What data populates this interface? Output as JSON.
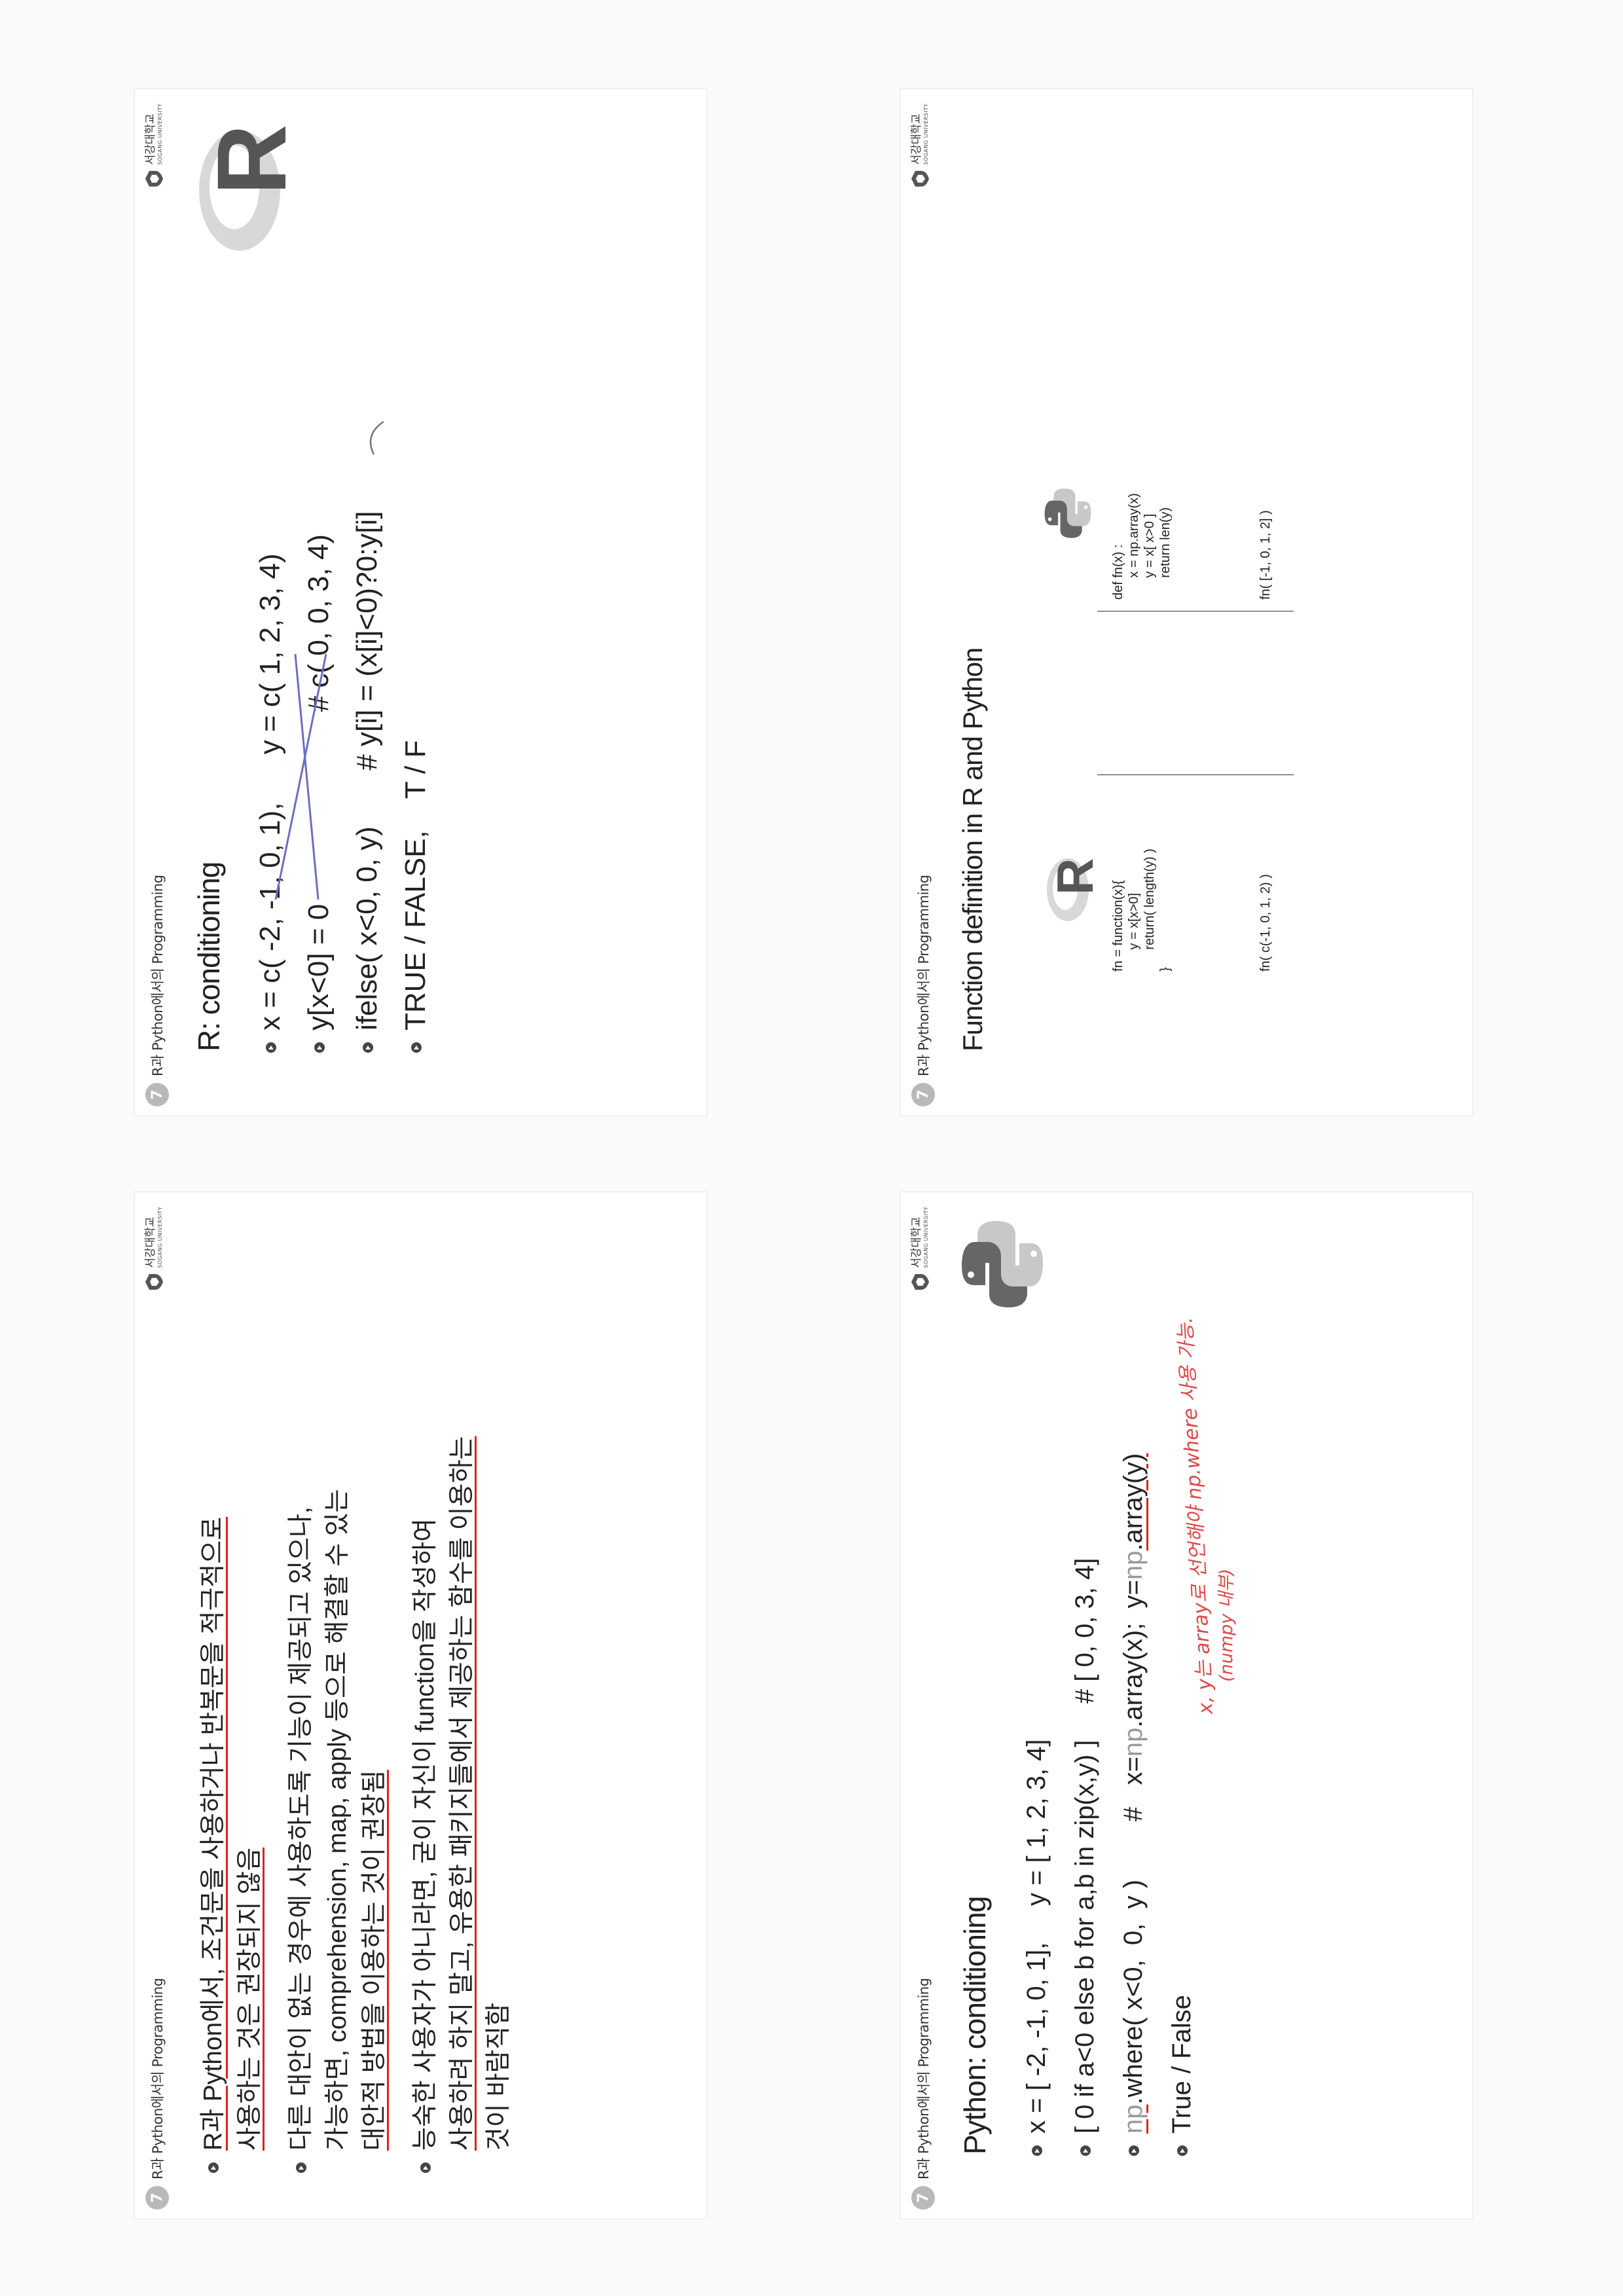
{
  "header": {
    "slide_number": "7",
    "course": "R과 Python에서의 Programming",
    "univ_ko": "서강대학교",
    "univ_en": "SOGANG UNIVERSITY"
  },
  "slide1": {
    "bullets": [
      {
        "lines": [
          "R과 Python에서, 조건문을 사용하거나 반복문을 적극적으로",
          "사용하는 것은 권장되지 않음"
        ]
      },
      {
        "lines": [
          "다른 대안이 없는 경우에 사용하도록 기능이 제공되고 있으나,",
          "가능하면, comprehension, map, apply 등으로 해결할 수 있는",
          "대안적 방법을 이용하는 것이 권장됨"
        ]
      },
      {
        "lines": [
          "능숙한 사용자가 아니라면, 굳이 자신이 function을 작성하여",
          "사용하려 하지 말고, 유용한 패키지들에서 제공하는 함수를 이용하는",
          "것이 바람직함"
        ]
      }
    ]
  },
  "slide2": {
    "title": "R: conditioning",
    "bullets": [
      "x = c( -2, -1, 0, 1),      y = c( 1, 2, 3, 4)",
      "y[x<0] = 0                        # c( 0, 0, 3, 4)",
      "ifelse( x<0, 0, y)       # y[i] = (x[i]<0)?0:y[i]",
      "TRUE / FALSE,    T / F"
    ],
    "logo": "R"
  },
  "slide3": {
    "title": "Python: conditioning",
    "b1": "x = [ -2, -1, 0, 1],     y = [ 1, 2, 3, 4]",
    "b2": "[ 0 if a<0 else b for a,b in zip(x,y) ]     # [ 0, 0, 3, 4]",
    "b3_np": "np",
    "b3_rest": ".where( x<0,  0,  y )        #   x=",
    "b3_np2": "np",
    "b3_mid": ".array(x);  y=",
    "b3_np3": "np",
    "b3_end": ".array(y)",
    "b4": "True / False",
    "handwriting_1": "x, y는 array로 선언해야 np.where 사용 가능.",
    "handwriting_2": "(numpy 내부)"
  },
  "slide4": {
    "title": "Function definition in R and Python",
    "r_logo": "R",
    "r_code": "fn = function(x){\n      y = x[x>0]\n      return( length(y) )\n}",
    "r_call": "fn( c(-1, 0, 1, 2) )",
    "py_code": "def fn(x) :\n      x = np.array(x)\n      y = x[ x>0 ]\n      return len(y)",
    "py_call": "fn( [-1, 0, 1, 2] )"
  }
}
